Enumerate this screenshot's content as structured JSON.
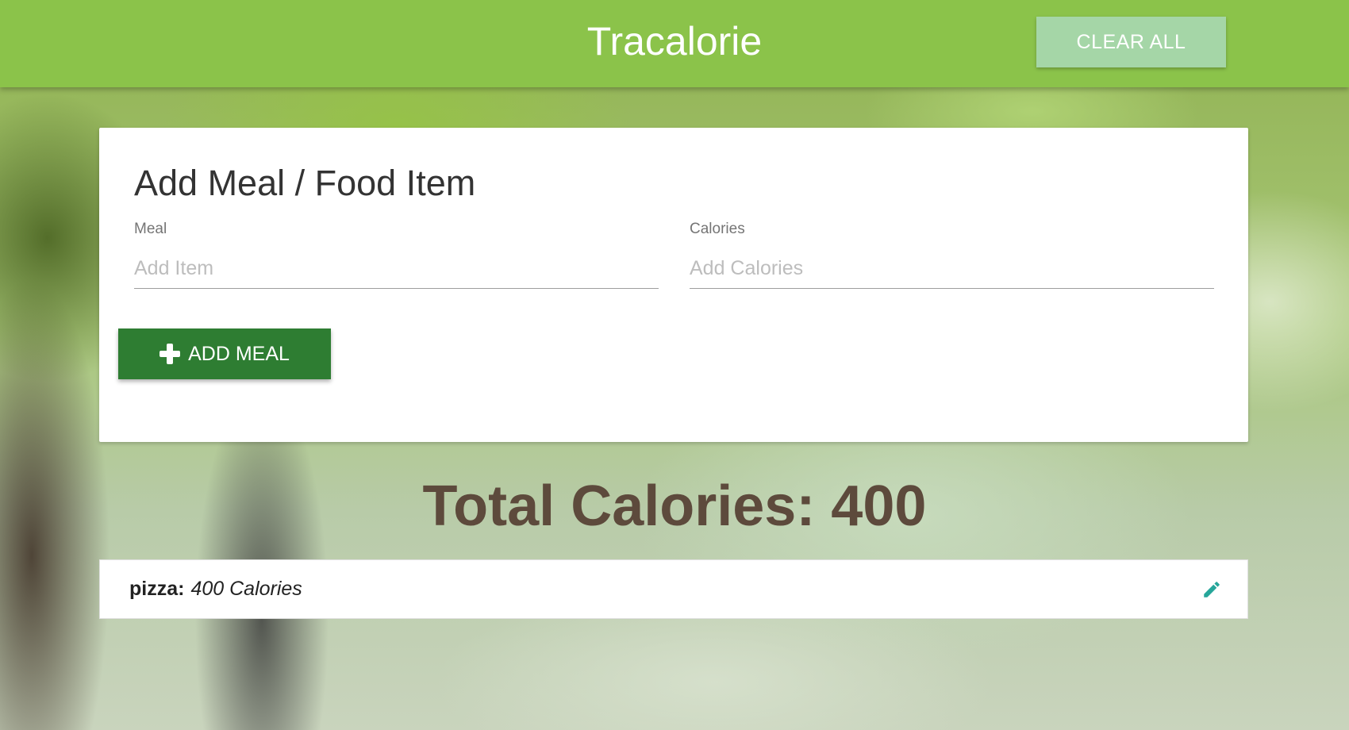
{
  "navbar": {
    "brand": "Tracalorie",
    "clear_label": "CLEAR ALL"
  },
  "form": {
    "title": "Add Meal / Food Item",
    "meal_label": "Meal",
    "meal_placeholder": "Add Item",
    "meal_value": "",
    "calories_label": "Calories",
    "calories_placeholder": "Add Calories",
    "calories_value": "",
    "add_label": "ADD MEAL"
  },
  "total": {
    "text": "Total Calories: 400"
  },
  "items": [
    {
      "name": "pizza:",
      "calories": "400 Calories"
    }
  ],
  "colors": {
    "navbar": "#8bc34a",
    "clear_button": "#a5d6a7",
    "add_button": "#2e7d32",
    "total_text": "#5d4a3c",
    "edit_icon": "#26a69a"
  },
  "icons": {
    "add": "plus-icon",
    "edit": "pencil-icon"
  }
}
